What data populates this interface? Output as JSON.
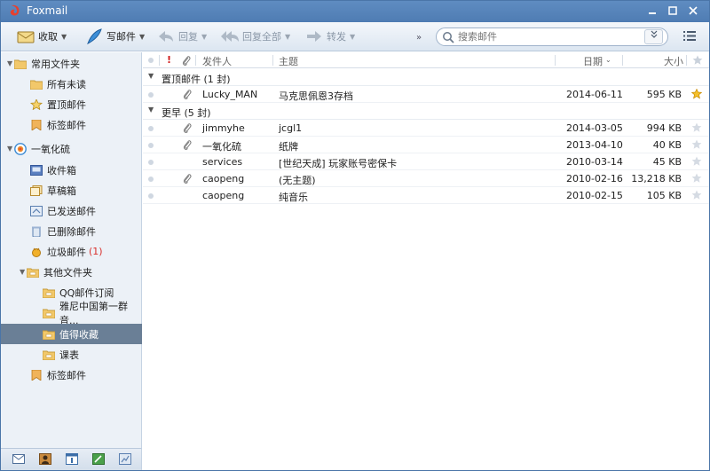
{
  "window": {
    "title": "Foxmail"
  },
  "toolbar": {
    "receive": "收取",
    "compose": "写邮件",
    "reply": "回复",
    "reply_all": "回复全部",
    "forward": "转发",
    "more": "»",
    "search_placeholder": "搜索邮件"
  },
  "sidebar": {
    "common_folders": "常用文件夹",
    "all_unread": "所有未读",
    "pinned": "置顶邮件",
    "tagged": "标签邮件",
    "account": "一氧化硫",
    "inbox": "收件箱",
    "drafts": "草稿箱",
    "sent": "已发送邮件",
    "deleted": "已删除邮件",
    "junk": "垃圾邮件",
    "junk_count": "(1)",
    "other_folders": "其他文件夹",
    "qq_subscription": "QQ邮件订阅",
    "sony_group": "雅尼中国第一群音...",
    "worth_saving": "值得收藏",
    "schedule": "课表",
    "account_tagged": "标签邮件"
  },
  "list": {
    "header": {
      "flag": "!",
      "from": "发件人",
      "subject": "主题",
      "date": "日期",
      "size": "大小"
    },
    "groups": [
      {
        "title": "置顶邮件 (1 封)"
      },
      {
        "title": "更早 (5 封)"
      }
    ],
    "pinned_rows": [
      {
        "from": "Lucky_MAN",
        "subject": "马克思佩恩3存档",
        "date": "2014-06-11",
        "size": "595 KB",
        "attachment": true,
        "starred": true
      }
    ],
    "rows": [
      {
        "from": "jimmyhe",
        "subject": "jcgl1",
        "date": "2014-03-05",
        "size": "994 KB",
        "attachment": true,
        "starred": false
      },
      {
        "from": "一氧化硫",
        "subject": "纸牌",
        "date": "2013-04-10",
        "size": "40 KB",
        "attachment": true,
        "starred": false
      },
      {
        "from": "services",
        "subject": "[世纪天成] 玩家账号密保卡",
        "date": "2010-03-14",
        "size": "45 KB",
        "attachment": false,
        "starred": false
      },
      {
        "from": "caopeng",
        "subject": "(无主题)",
        "date": "2010-02-16",
        "size": "13,218 KB",
        "attachment": true,
        "starred": false
      },
      {
        "from": "caopeng",
        "subject": "纯音乐",
        "date": "2010-02-15",
        "size": "105 KB",
        "attachment": false,
        "starred": false
      }
    ]
  },
  "colors": {
    "accent": "#4f7cb3",
    "selected_folder": "#6a7f96",
    "star_active": "#f5b400",
    "count": "#d9302c"
  }
}
